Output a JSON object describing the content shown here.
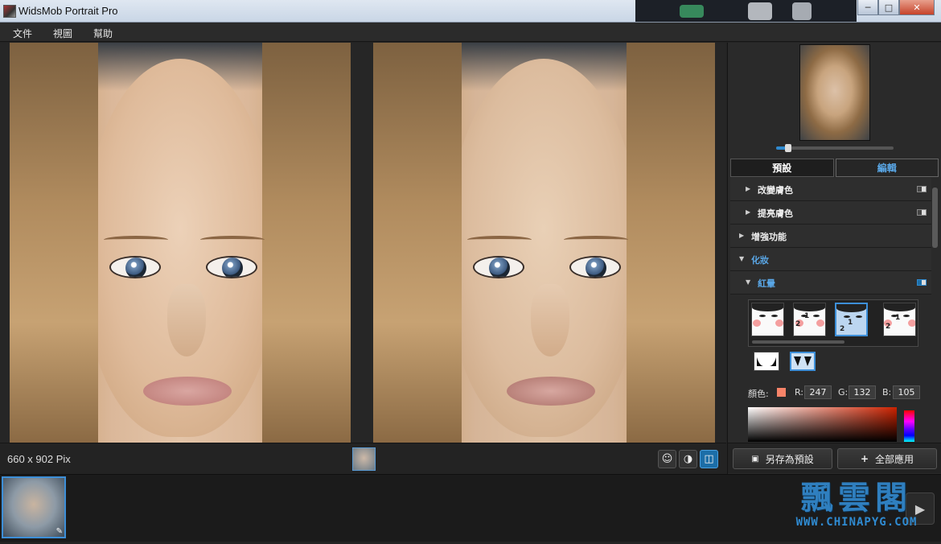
{
  "window": {
    "title": "WidsMob Portrait Pro"
  },
  "menu": [
    "文件",
    "視圖",
    "幫助"
  ],
  "status": {
    "dimensions": "660 x 902 Pix"
  },
  "panel": {
    "zoom_level": 0.1,
    "tabs": [
      {
        "label": "預設",
        "active": false
      },
      {
        "label": "編輯",
        "active": true
      }
    ],
    "sections": [
      {
        "label": "改變膚色",
        "expanded": false,
        "toggle": true,
        "enabled": false
      },
      {
        "label": "提亮膚色",
        "expanded": false,
        "toggle": true,
        "enabled": false
      },
      {
        "label": "增強功能",
        "expanded": false,
        "toggle": false
      },
      {
        "label": "化妝",
        "expanded": true,
        "toggle": false
      },
      {
        "label": "紅暈",
        "expanded": true,
        "toggle": true,
        "enabled": true
      }
    ],
    "blush_styles": [
      "1",
      "2",
      "3",
      "4"
    ],
    "selected_blush_style": 3,
    "color": {
      "label": "顏色:",
      "swatch": "#f78469",
      "r_label": "R:",
      "r": "247",
      "g_label": "G:",
      "g": "132",
      "b_label": "B:",
      "b": "105"
    },
    "save_preset_label": "另存為預設",
    "apply_all_label": "全部應用"
  },
  "watermark": {
    "title": "飄雲閣",
    "url": "WWW.CHINAPYG.COM"
  },
  "colors": {
    "accent": "#2f8ad0",
    "panel_bg": "#2a2a2a"
  }
}
